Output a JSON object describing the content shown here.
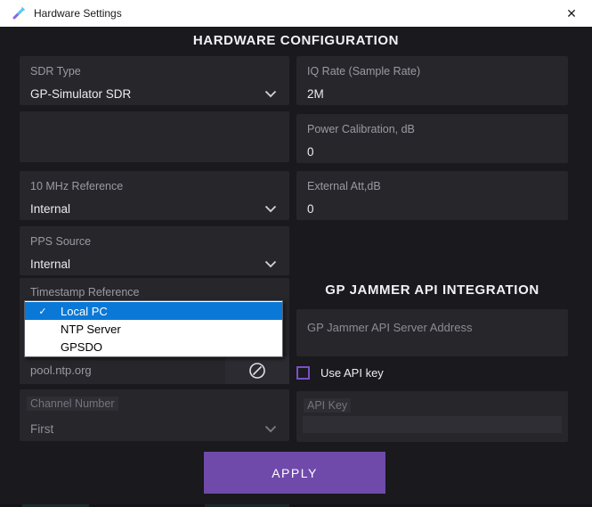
{
  "window": {
    "title": "Hardware Settings"
  },
  "icons": {
    "close": "✕",
    "check": "✓"
  },
  "main": {
    "header": "HARDWARE CONFIGURATION"
  },
  "left_column": {
    "sdr_type": {
      "label": "SDR Type",
      "value": "GP-Simulator SDR"
    },
    "reference_10mhz": {
      "label": "10 MHz Reference",
      "value": "Internal"
    },
    "pps_source": {
      "label": "PPS Source",
      "value": "Internal"
    },
    "timestamp_reference": {
      "label": "Timestamp Reference",
      "ntp_server_placeholder": "pool.ntp.org",
      "menu_items": [
        {
          "label": "Local PC",
          "selected": true
        },
        {
          "label": "NTP Server",
          "selected": false
        },
        {
          "label": "GPSDO",
          "selected": false
        }
      ]
    },
    "channel_number": {
      "label": "Channel Number",
      "value": "First"
    }
  },
  "right_column": {
    "iq_rate": {
      "label": "IQ Rate (Sample Rate)",
      "value": "2M"
    },
    "power_calibration": {
      "label": "Power Calibration, dB",
      "value": "0"
    },
    "external_att": {
      "label": "External Att,dB",
      "value": "0"
    },
    "api_integration": {
      "header": "GP JAMMER API INTEGRATION",
      "server_address_placeholder": "GP Jammer API Server Address",
      "use_api_key_label": "Use API key",
      "api_key_label": "API Key",
      "api_key_value": ""
    }
  },
  "footer": {
    "apply_label": "APPLY"
  },
  "colors": {
    "accent_purple": "#6f4aab",
    "checkbox_purple": "#7a50c8",
    "menu_highlight_blue": "#0a78d7",
    "titlebar_icon_cyan": "#55c8f2",
    "titlebar_icon_purple": "#8a63e8"
  }
}
